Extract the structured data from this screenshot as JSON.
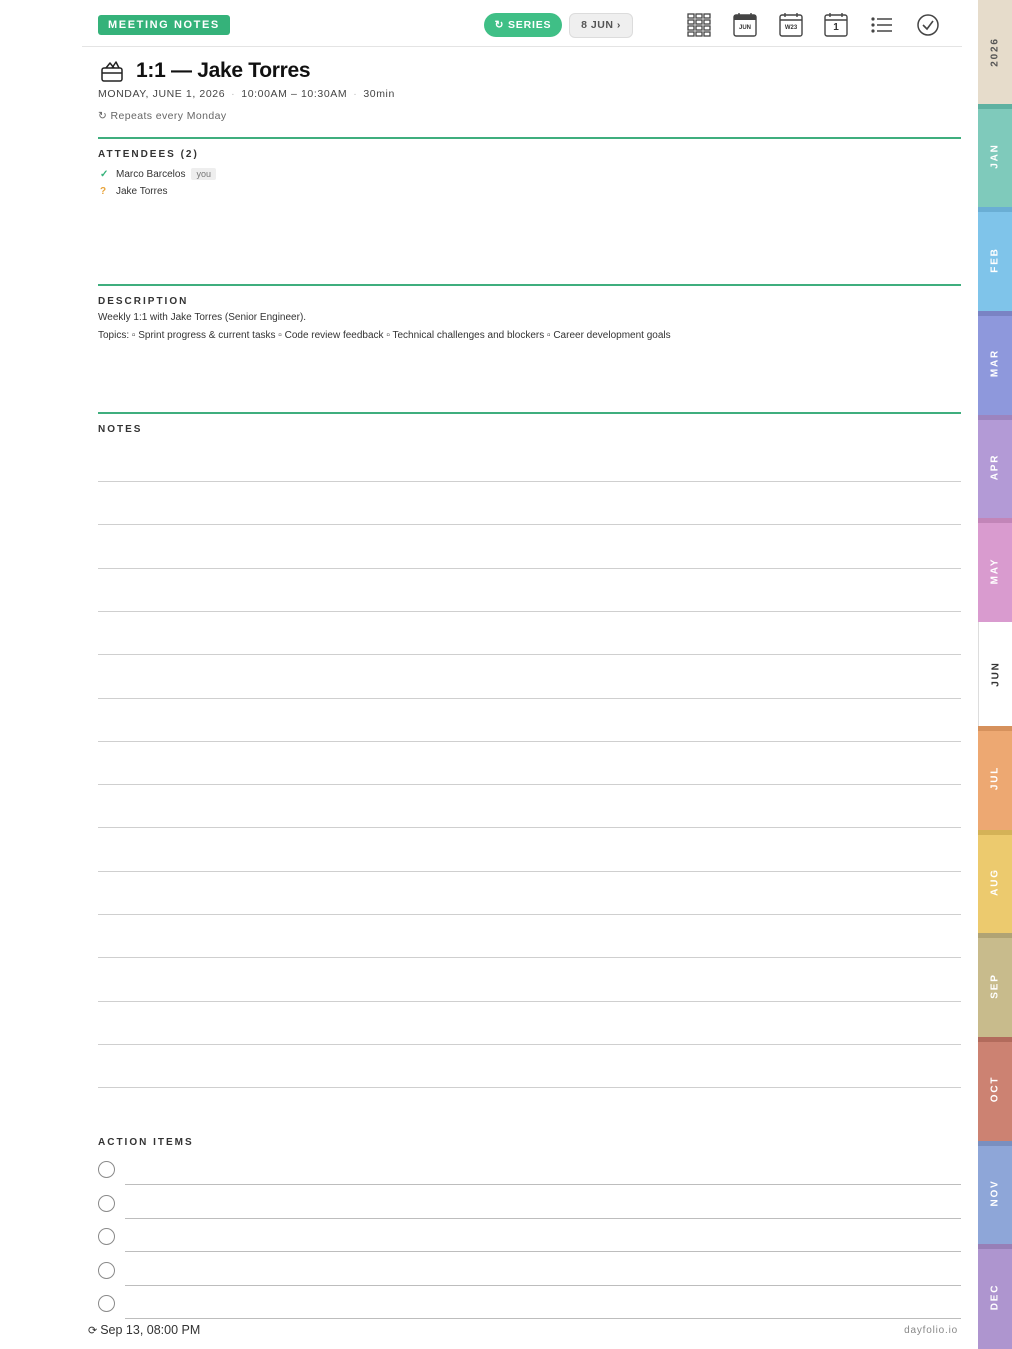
{
  "header": {
    "badge": "MEETING NOTES",
    "series_button": "↻ SERIES",
    "next_button": "8 JUN ›",
    "icons": [
      "year-grid-icon",
      "month-calendar-icon",
      "week-calendar-icon",
      "day-calendar-icon",
      "list-icon",
      "check-circle-icon"
    ],
    "month_icon_text": "JUN",
    "week_icon_text": "W23",
    "day_icon_text": "1"
  },
  "meeting": {
    "title": "1:1 — Jake Torres",
    "date": "MONDAY, JUNE 1, 2026",
    "time": "10:00AM – 10:30AM",
    "duration": "30min",
    "repeat": "↻ Repeats every Monday"
  },
  "attendees": {
    "label": "ATTENDEES (2)",
    "items": [
      {
        "status": "✓",
        "name": "Marco Barcelos",
        "tag": "you"
      },
      {
        "status": "?",
        "name": "Jake Torres",
        "tag": ""
      }
    ]
  },
  "description": {
    "label": "DESCRIPTION",
    "line1": "Weekly 1:1 with Jake Torres (Senior Engineer).",
    "line2": "Topics: ▫ Sprint progress & current tasks ▫ Code review feedback ▫ Technical challenges and blockers ▫ Career development goals"
  },
  "notes": {
    "label": "NOTES"
  },
  "action_items": {
    "label": "ACTION ITEMS"
  },
  "footer": {
    "sync": "Sep 13, 08:00 PM",
    "brand": "dayfolio.io"
  },
  "tabs": [
    {
      "label": "2026",
      "color": "#e6dccb",
      "strip": "#e6dccb",
      "text": "#555555"
    },
    {
      "label": "JAN",
      "color": "#7fcabb",
      "strip": "#5fb1a1"
    },
    {
      "label": "FEB",
      "color": "#7fc4ea",
      "strip": "#6aaed4"
    },
    {
      "label": "MAR",
      "color": "#8e98dc",
      "strip": "#7a83c4"
    },
    {
      "label": "APR",
      "color": "#b39ad6",
      "strip": "#9c84bf"
    },
    {
      "label": "MAY",
      "color": "#d99bcf",
      "strip": "#c285b8"
    },
    {
      "label": "JUN",
      "color": "#ffffff",
      "strip": "#ffffff",
      "text": "#333333",
      "active": true
    },
    {
      "label": "JUL",
      "color": "#eda872",
      "strip": "#d6915c"
    },
    {
      "label": "AUG",
      "color": "#ecca6e",
      "strip": "#d4b257"
    },
    {
      "label": "SEP",
      "color": "#c8bb8c",
      "strip": "#b0a374"
    },
    {
      "label": "OCT",
      "color": "#cc8272",
      "strip": "#b26b5c"
    },
    {
      "label": "NOV",
      "color": "#8ea6d8",
      "strip": "#798fc0"
    },
    {
      "label": "DEC",
      "color": "#ae95cf",
      "strip": "#977fb7"
    }
  ]
}
